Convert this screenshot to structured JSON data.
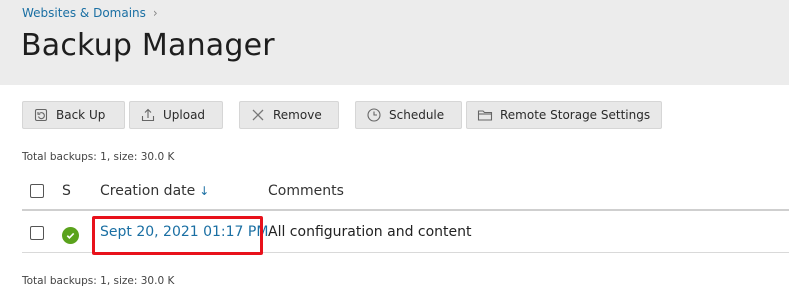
{
  "breadcrumb": {
    "parent": "Websites & Domains",
    "separator": "›"
  },
  "page": {
    "title": "Backup Manager"
  },
  "toolbar": {
    "back_up": "Back Up",
    "upload": "Upload",
    "remove": "Remove",
    "schedule": "Schedule",
    "remote_storage": "Remote Storage Settings"
  },
  "summary_top": "Total backups: 1, size: 30.0 K",
  "summary_bottom": "Total backups: 1, size: 30.0 K",
  "table": {
    "headers": {
      "status": "S",
      "creation_date": "Creation date",
      "sort_indicator": "↓",
      "comments": "Comments"
    },
    "rows": [
      {
        "status": "ok",
        "creation_date": "Sept 20, 2021 01:17 PM",
        "comments": "All configuration and content"
      }
    ]
  },
  "colors": {
    "accent": "#1a6fa3",
    "highlight": "#e8111b",
    "status_ok": "#5aa21c",
    "header_bg": "#ececec"
  },
  "icons": {
    "back_up": "backup-icon",
    "upload": "upload-icon",
    "remove": "remove-icon",
    "schedule": "clock-icon",
    "remote_storage": "folder-icon"
  }
}
